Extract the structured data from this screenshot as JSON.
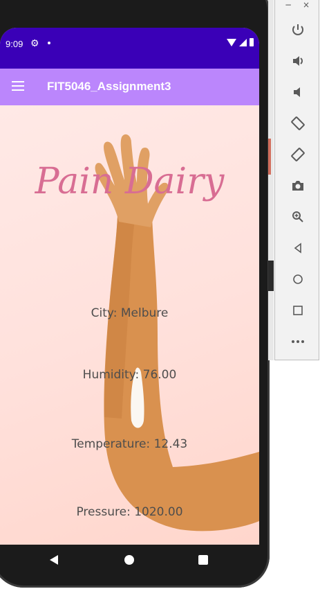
{
  "status_bar": {
    "time": "9:09"
  },
  "app_bar": {
    "title": "FIT5046_Assignment3"
  },
  "logo": "Pain Dairy",
  "weather": {
    "city": "City: Melbure",
    "humidity": "Humidity: 76.00",
    "temperature": "Temperature: 12.43",
    "pressure": "Pressure: 1020.00"
  },
  "emulator_toolbar": {
    "window_controls": [
      "−",
      "×"
    ],
    "buttons": [
      "power-icon",
      "volume-up-icon",
      "volume-down-icon",
      "rotate-left-icon",
      "rotate-right-icon",
      "camera-icon",
      "zoom-icon",
      "back-icon",
      "home-icon",
      "overview-icon",
      "more-icon"
    ]
  },
  "colors": {
    "status_bar": "#3a00b7",
    "app_bar": "#bb86fc",
    "logo": "#d86d93"
  }
}
